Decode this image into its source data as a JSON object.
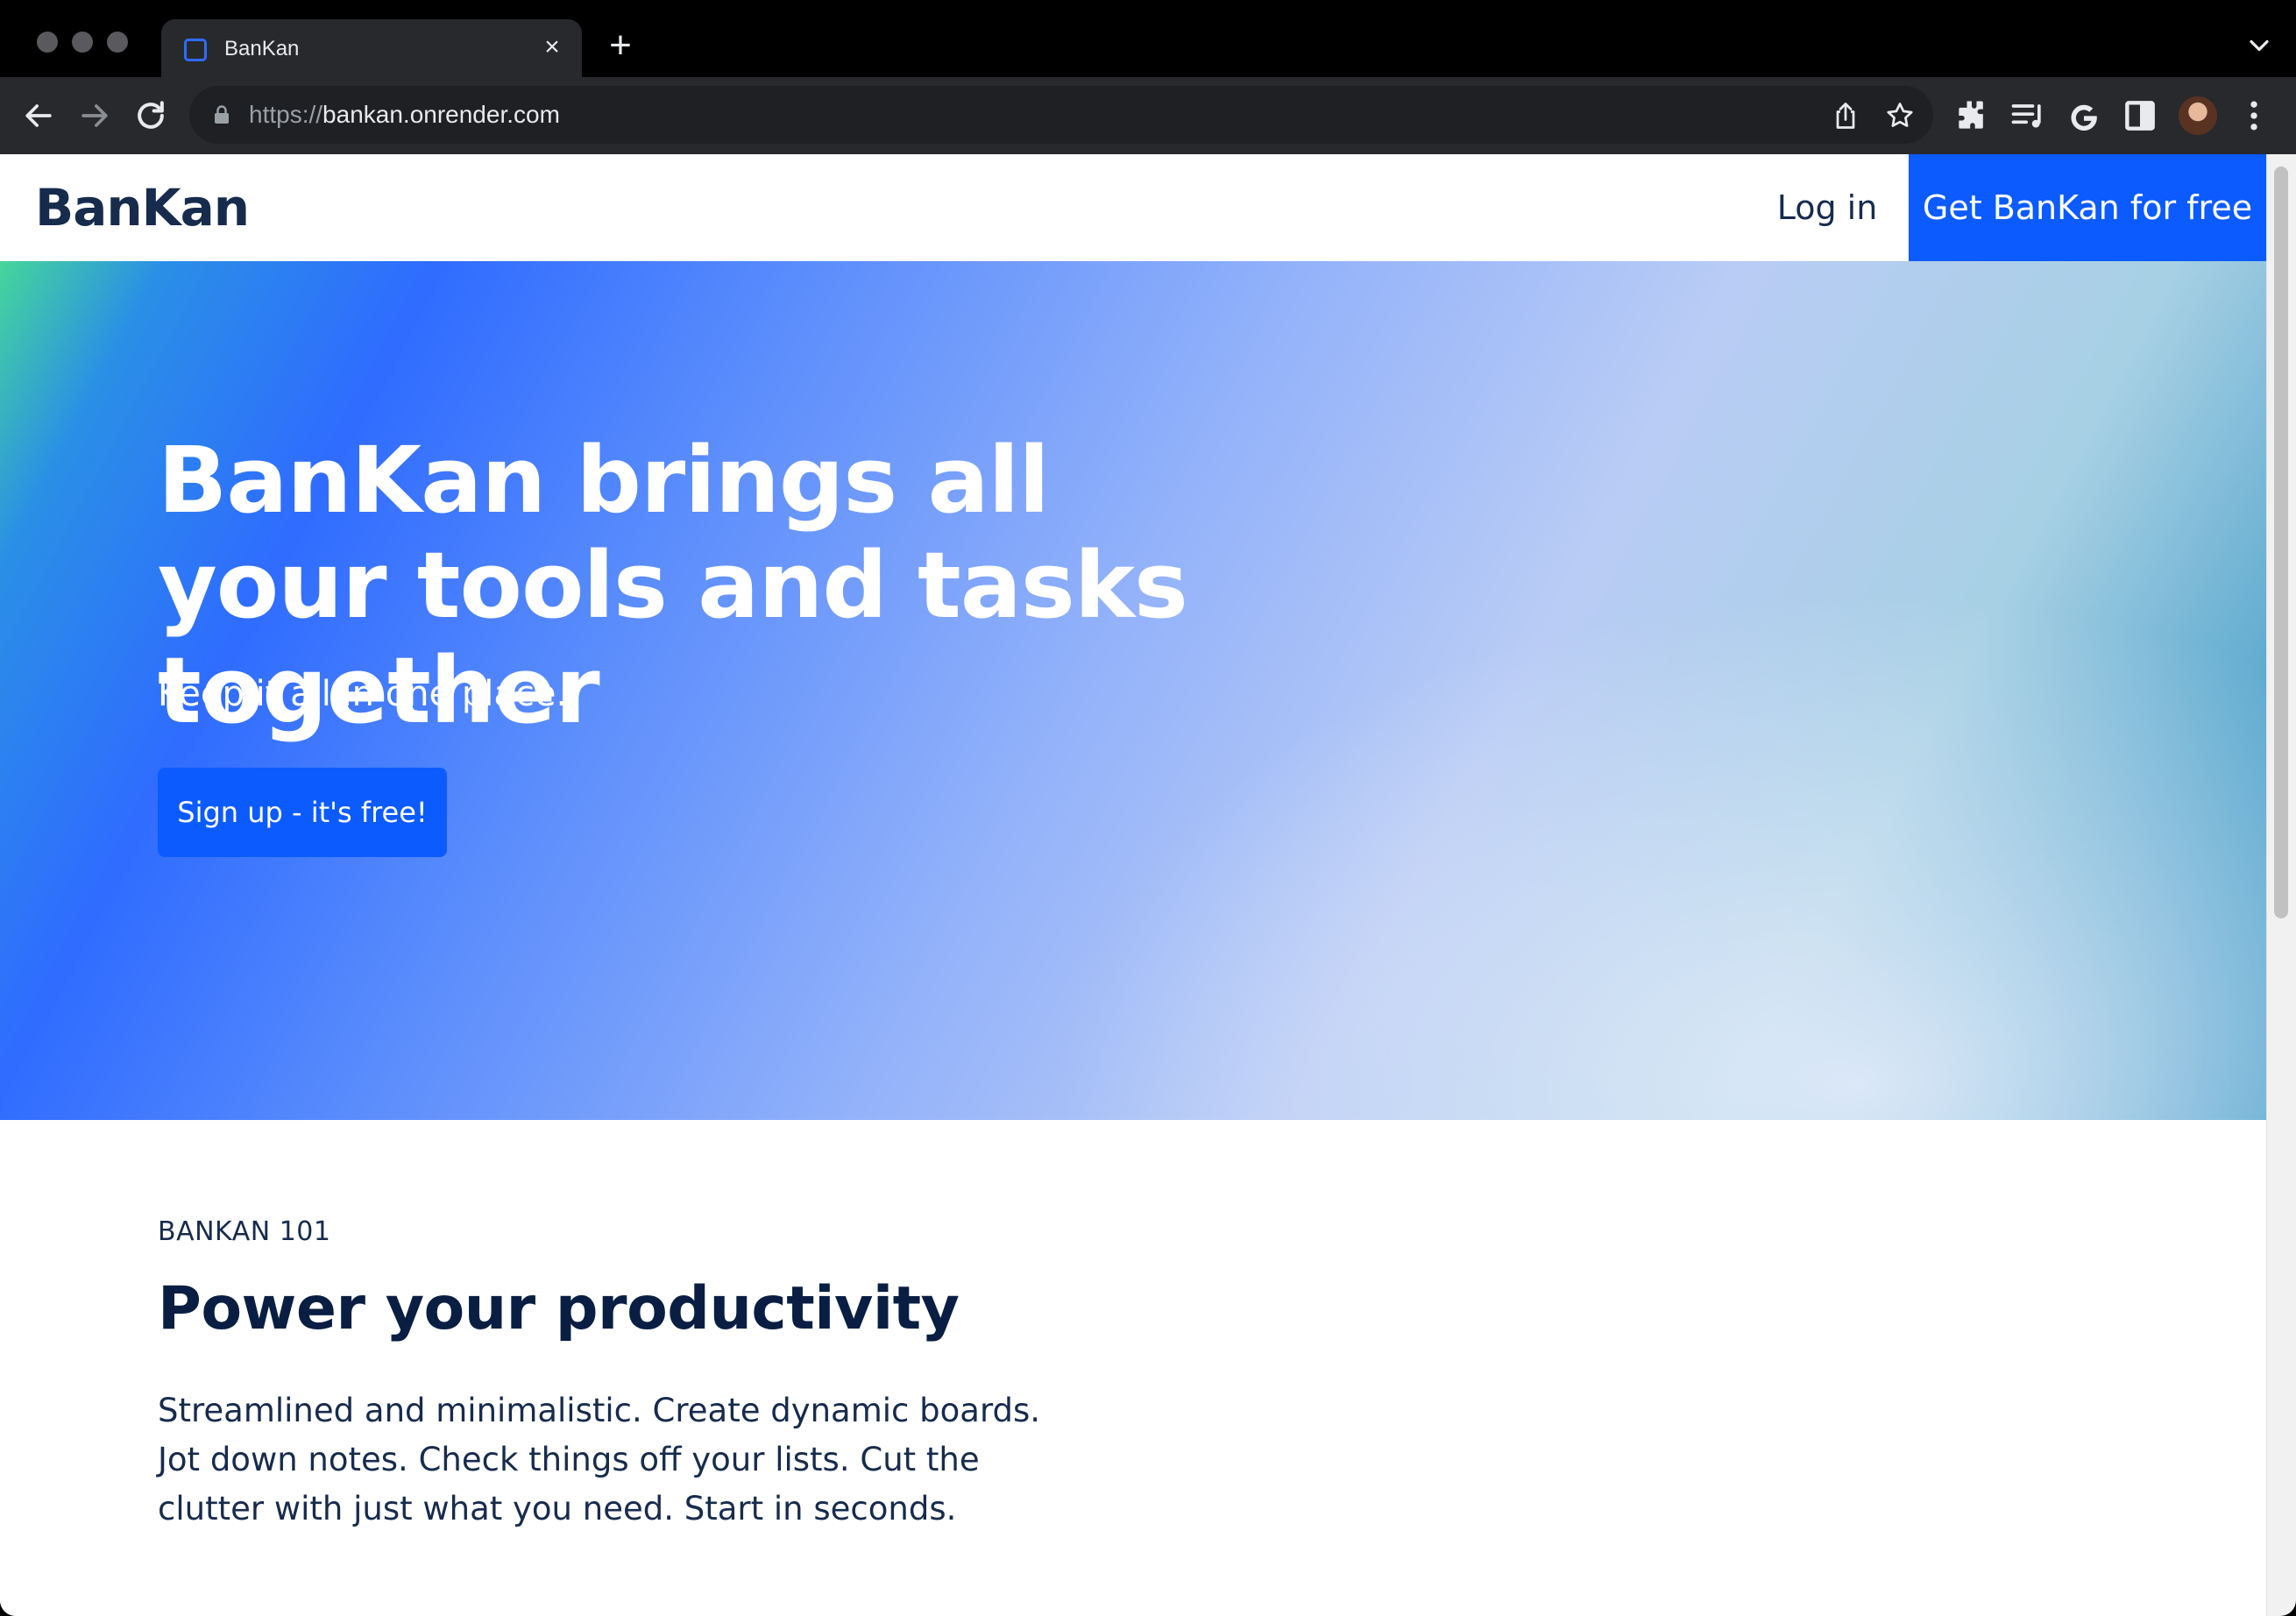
{
  "browser": {
    "tab": {
      "title": "BanKan",
      "close_glyph": "×",
      "favicon_icon": "bankan-favicon-icon"
    },
    "new_tab_glyph": "+",
    "address": {
      "scheme": "https://",
      "host": "bankan.onrender.com"
    },
    "icons": [
      "back-icon",
      "forward-icon",
      "reload-icon",
      "lock-icon",
      "share-icon",
      "bookmark-star-icon",
      "extensions-icon",
      "reading-list-icon",
      "google-icon",
      "side-panel-icon",
      "profile-avatar",
      "menu-dots-icon"
    ],
    "colors": {
      "frame": "#000000",
      "toolbar": "#28292c",
      "omnibox": "#1f2023"
    }
  },
  "site": {
    "brand": "BanKan",
    "nav": {
      "login": "Log in",
      "cta": "Get BanKan for free"
    },
    "hero": {
      "title": "BanKan brings all your tools and tasks together",
      "subtitle": "Keep it all in one place.",
      "button": "Sign up - it's free!"
    },
    "section": {
      "eyebrow": "BANKAN 101",
      "title": "Power your productivity",
      "body": "Streamlined and minimalistic. Create dynamic boards. Jot down notes. Check things off your lists. Cut the clutter with just what you need. Start in seconds."
    },
    "colors": {
      "primary": "#0c5bff",
      "heading": "#091e42",
      "text": "#172b4d"
    }
  }
}
